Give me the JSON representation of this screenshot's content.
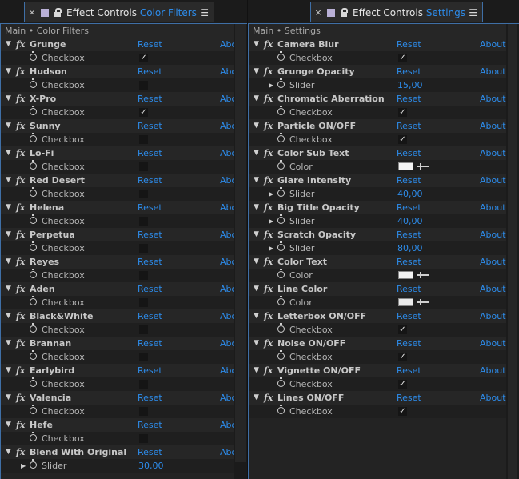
{
  "panels": [
    {
      "tab_label": "Effect Controls",
      "tab_accent": "Color Filters",
      "breadcrumb": "Main • Color Filters",
      "reset_label": "Reset",
      "about_label": "Abo",
      "effects": [
        {
          "name": "Grunge",
          "param": "Checkbox",
          "kind": "checkbox",
          "checked": "✓"
        },
        {
          "name": "Hudson",
          "param": "Checkbox",
          "kind": "checkbox",
          "checked": ""
        },
        {
          "name": "X-Pro",
          "param": "Checkbox",
          "kind": "checkbox",
          "checked": "✓"
        },
        {
          "name": "Sunny",
          "param": "Checkbox",
          "kind": "checkbox",
          "checked": ""
        },
        {
          "name": "Lo-Fi",
          "param": "Checkbox",
          "kind": "checkbox",
          "checked": ""
        },
        {
          "name": "Red Desert",
          "param": "Checkbox",
          "kind": "checkbox",
          "checked": ""
        },
        {
          "name": "Helena",
          "param": "Checkbox",
          "kind": "checkbox",
          "checked": ""
        },
        {
          "name": "Perpetua",
          "param": "Checkbox",
          "kind": "checkbox",
          "checked": ""
        },
        {
          "name": "Reyes",
          "param": "Checkbox",
          "kind": "checkbox",
          "checked": ""
        },
        {
          "name": "Aden",
          "param": "Checkbox",
          "kind": "checkbox",
          "checked": ""
        },
        {
          "name": "Black&White",
          "param": "Checkbox",
          "kind": "checkbox",
          "checked": ""
        },
        {
          "name": "Brannan",
          "param": "Checkbox",
          "kind": "checkbox",
          "checked": ""
        },
        {
          "name": "Earlybird",
          "param": "Checkbox",
          "kind": "checkbox",
          "checked": ""
        },
        {
          "name": "Valencia",
          "param": "Checkbox",
          "kind": "checkbox",
          "checked": ""
        },
        {
          "name": "Hefe",
          "param": "Checkbox",
          "kind": "checkbox",
          "checked": ""
        },
        {
          "name": "Blend With Original",
          "param": "Slider",
          "kind": "slider",
          "value": "30,00"
        }
      ]
    },
    {
      "tab_label": "Effect Controls",
      "tab_accent": "Settings",
      "breadcrumb": "Main • Settings",
      "reset_label": "Reset",
      "about_label": "About",
      "effects": [
        {
          "name": "Camera Blur",
          "param": "Checkbox",
          "kind": "checkbox",
          "checked": "✓"
        },
        {
          "name": "Grunge Opacity",
          "param": "Slider",
          "kind": "slider",
          "value": "15,00"
        },
        {
          "name": "Chromatic Aberration",
          "param": "Checkbox",
          "kind": "checkbox",
          "checked": "✓"
        },
        {
          "name": "Particle ON/OFF",
          "param": "Checkbox",
          "kind": "checkbox",
          "checked": "✓"
        },
        {
          "name": "Color Sub Text",
          "param": "Color",
          "kind": "color",
          "color": "#f4f4f4"
        },
        {
          "name": "Glare Intensity",
          "param": "Slider",
          "kind": "slider",
          "value": "40,00"
        },
        {
          "name": "Big Title Opacity",
          "param": "Slider",
          "kind": "slider",
          "value": "40,00"
        },
        {
          "name": "Scratch Opacity",
          "param": "Slider",
          "kind": "slider",
          "value": "80,00"
        },
        {
          "name": "Color Text",
          "param": "Color",
          "kind": "color",
          "color": "#f4f4f4"
        },
        {
          "name": "Line Color",
          "param": "Color",
          "kind": "color",
          "color": "#eaeaea"
        },
        {
          "name": "Letterbox ON/OFF",
          "param": "Checkbox",
          "kind": "checkbox",
          "checked": "✓"
        },
        {
          "name": "Noise ON/OFF",
          "param": "Checkbox",
          "kind": "checkbox",
          "checked": "✓"
        },
        {
          "name": "Vignette ON/OFF",
          "param": "Checkbox",
          "kind": "checkbox",
          "checked": "✓"
        },
        {
          "name": "Lines ON/OFF",
          "param": "Checkbox",
          "kind": "checkbox",
          "checked": "✓"
        }
      ]
    }
  ],
  "icons": {
    "close": "×",
    "menu": "☰",
    "twirl_open": "▼",
    "twirl_closed": "▶",
    "fx": "fx"
  },
  "colors": {
    "accent": "#2d8ceb",
    "panel_border": "#3f6fa6"
  }
}
